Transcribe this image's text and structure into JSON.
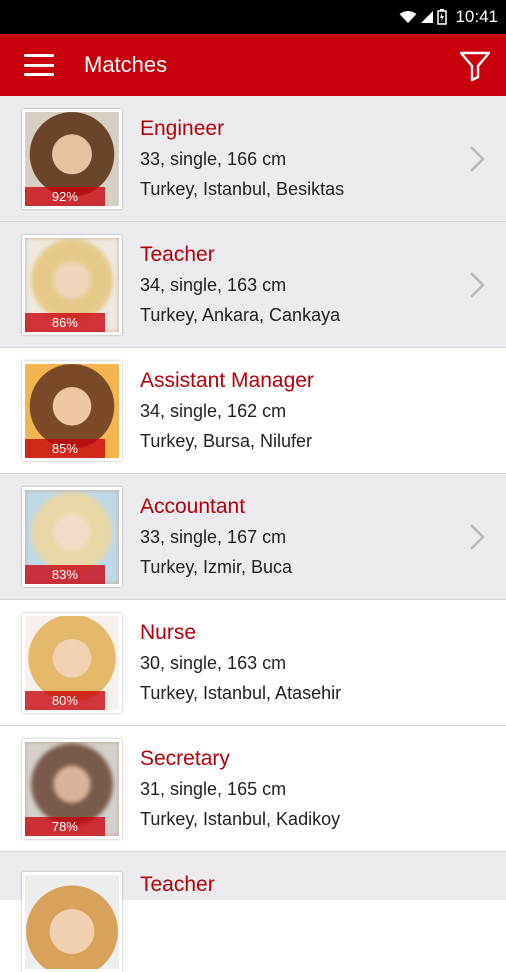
{
  "status": {
    "time": "10:41"
  },
  "appbar": {
    "title": "Matches"
  },
  "matches": [
    {
      "job": "Engineer",
      "details": "33, single, 166 cm",
      "location": "Turkey, Istanbul, Besiktas",
      "match": "92%",
      "shaded": true,
      "chevron": true
    },
    {
      "job": "Teacher",
      "details": "34, single, 163 cm",
      "location": "Turkey, Ankara, Cankaya",
      "match": "86%",
      "shaded": true,
      "chevron": true
    },
    {
      "job": "Assistant Manager",
      "details": "34, single, 162 cm",
      "location": "Turkey, Bursa, Nilufer",
      "match": "85%",
      "shaded": false,
      "chevron": false
    },
    {
      "job": "Accountant",
      "details": "33, single, 167 cm",
      "location": "Turkey, Izmir, Buca",
      "match": "83%",
      "shaded": true,
      "chevron": true
    },
    {
      "job": "Nurse",
      "details": "30, single, 163 cm",
      "location": "Turkey, Istanbul, Atasehir",
      "match": "80%",
      "shaded": false,
      "chevron": false
    },
    {
      "job": "Secretary",
      "details": "31, single, 165 cm",
      "location": "Turkey, Istanbul, Kadikoy",
      "match": "78%",
      "shaded": false,
      "chevron": false
    },
    {
      "job": "Teacher"
    }
  ]
}
